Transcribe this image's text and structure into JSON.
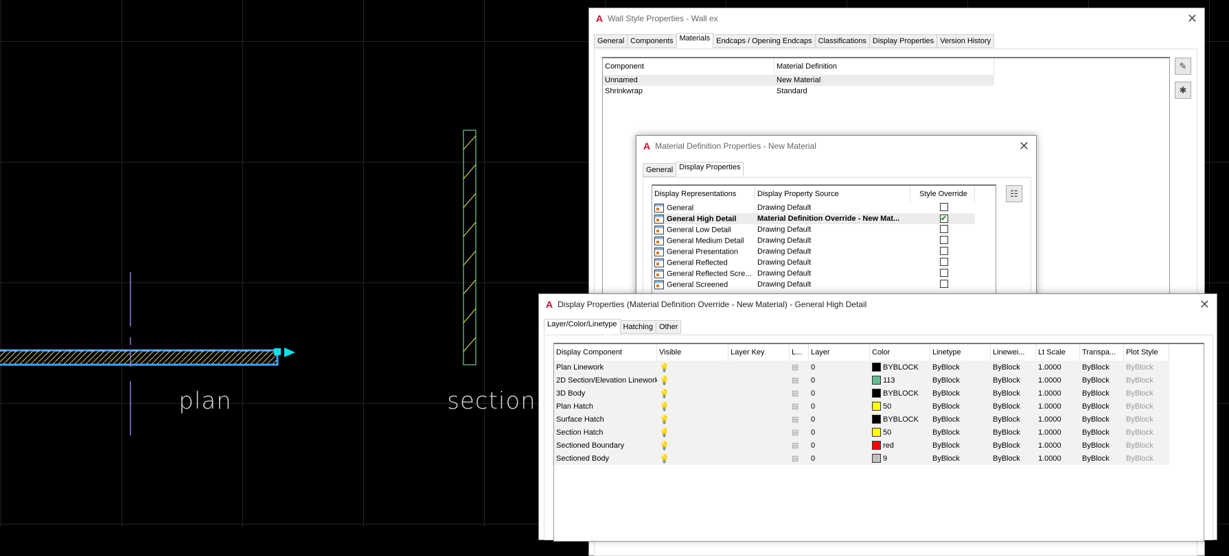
{
  "canvas": {
    "labels": {
      "plan": "plan",
      "section": "section"
    }
  },
  "wall_style_dialog": {
    "title": "Wall Style Properties - Wall ex",
    "tabs": [
      "General",
      "Components",
      "Materials",
      "Endcaps / Opening Endcaps",
      "Classifications",
      "Display Properties",
      "Version History"
    ],
    "active_tab": "Materials",
    "columns": [
      "Component",
      "Material Definition"
    ],
    "rows": [
      {
        "component": "Unnamed",
        "material": "New Material"
      },
      {
        "component": "Shrinkwrap",
        "material": "Standard"
      }
    ]
  },
  "material_dialog": {
    "title": "Material Definition Properties - New Material",
    "tabs": [
      "General",
      "Display Properties"
    ],
    "active_tab": "Display Properties",
    "columns": [
      "Display Representations",
      "Display Property Source",
      "Style Override"
    ],
    "rows": [
      {
        "name": "General",
        "source": "Drawing Default",
        "override": false
      },
      {
        "name": "General High Detail",
        "source": "Material Definition Override - New Mat...",
        "override": true
      },
      {
        "name": "General Low Detail",
        "source": "Drawing Default",
        "override": false
      },
      {
        "name": "General Medium Detail",
        "source": "Drawing Default",
        "override": false
      },
      {
        "name": "General Presentation",
        "source": "Drawing Default",
        "override": false
      },
      {
        "name": "General Reflected",
        "source": "Drawing Default",
        "override": false
      },
      {
        "name": "General Reflected Scre...",
        "source": "Drawing Default",
        "override": false
      },
      {
        "name": "General Screened",
        "source": "Drawing Default",
        "override": false
      }
    ]
  },
  "display_dialog": {
    "title": "Display Properties (Material Definition Override - New Material) - General High Detail",
    "tabs": [
      "Layer/Color/Linetype",
      "Hatching",
      "Other"
    ],
    "active_tab": "Layer/Color/Linetype",
    "columns": [
      "Display Component",
      "Visible",
      "Layer Key",
      "L...",
      "Layer",
      "Color",
      "Linetype",
      "Linewei...",
      "Lt Scale",
      "Transpa...",
      "Plot Style"
    ],
    "rows": [
      {
        "component": "Plan Linework",
        "visible": true,
        "layer": "0",
        "color": "BYBLOCK",
        "swatch": "#000000",
        "linetype": "ByBlock",
        "lineweight": "ByBlock",
        "lt_scale": "1.0000",
        "transparency": "ByBlock",
        "plot_style": "ByBlock"
      },
      {
        "component": "2D Section/Elevation Linework",
        "visible": true,
        "layer": "0",
        "color": "113",
        "swatch": "#5fc08f",
        "linetype": "ByBlock",
        "lineweight": "ByBlock",
        "lt_scale": "1.0000",
        "transparency": "ByBlock",
        "plot_style": "ByBlock"
      },
      {
        "component": "3D Body",
        "visible": true,
        "layer": "0",
        "color": "BYBLOCK",
        "swatch": "#000000",
        "linetype": "ByBlock",
        "lineweight": "ByBlock",
        "lt_scale": "1.0000",
        "transparency": "ByBlock",
        "plot_style": "ByBlock"
      },
      {
        "component": "Plan Hatch",
        "visible": true,
        "layer": "0",
        "color": "50",
        "swatch": "#ffff00",
        "linetype": "ByBlock",
        "lineweight": "ByBlock",
        "lt_scale": "1.0000",
        "transparency": "ByBlock",
        "plot_style": "ByBlock"
      },
      {
        "component": "Surface Hatch",
        "visible": false,
        "layer": "0",
        "color": "BYBLOCK",
        "swatch": "#000000",
        "linetype": "ByBlock",
        "lineweight": "ByBlock",
        "lt_scale": "1.0000",
        "transparency": "ByBlock",
        "plot_style": "ByBlock"
      },
      {
        "component": "Section Hatch",
        "visible": true,
        "layer": "0",
        "color": "50",
        "swatch": "#ffff00",
        "linetype": "ByBlock",
        "lineweight": "ByBlock",
        "lt_scale": "1.0000",
        "transparency": "ByBlock",
        "plot_style": "ByBlock"
      },
      {
        "component": "Sectioned Boundary",
        "visible": true,
        "layer": "0",
        "color": "red",
        "swatch": "#ff0000",
        "linetype": "ByBlock",
        "lineweight": "ByBlock",
        "lt_scale": "1.0000",
        "transparency": "ByBlock",
        "plot_style": "ByBlock"
      },
      {
        "component": "Sectioned Body",
        "visible": true,
        "layer": "0",
        "color": "9",
        "swatch": "#c0c0c0",
        "linetype": "ByBlock",
        "lineweight": "ByBlock",
        "lt_scale": "1.0000",
        "transparency": "ByBlock",
        "plot_style": "ByBlock"
      }
    ]
  }
}
